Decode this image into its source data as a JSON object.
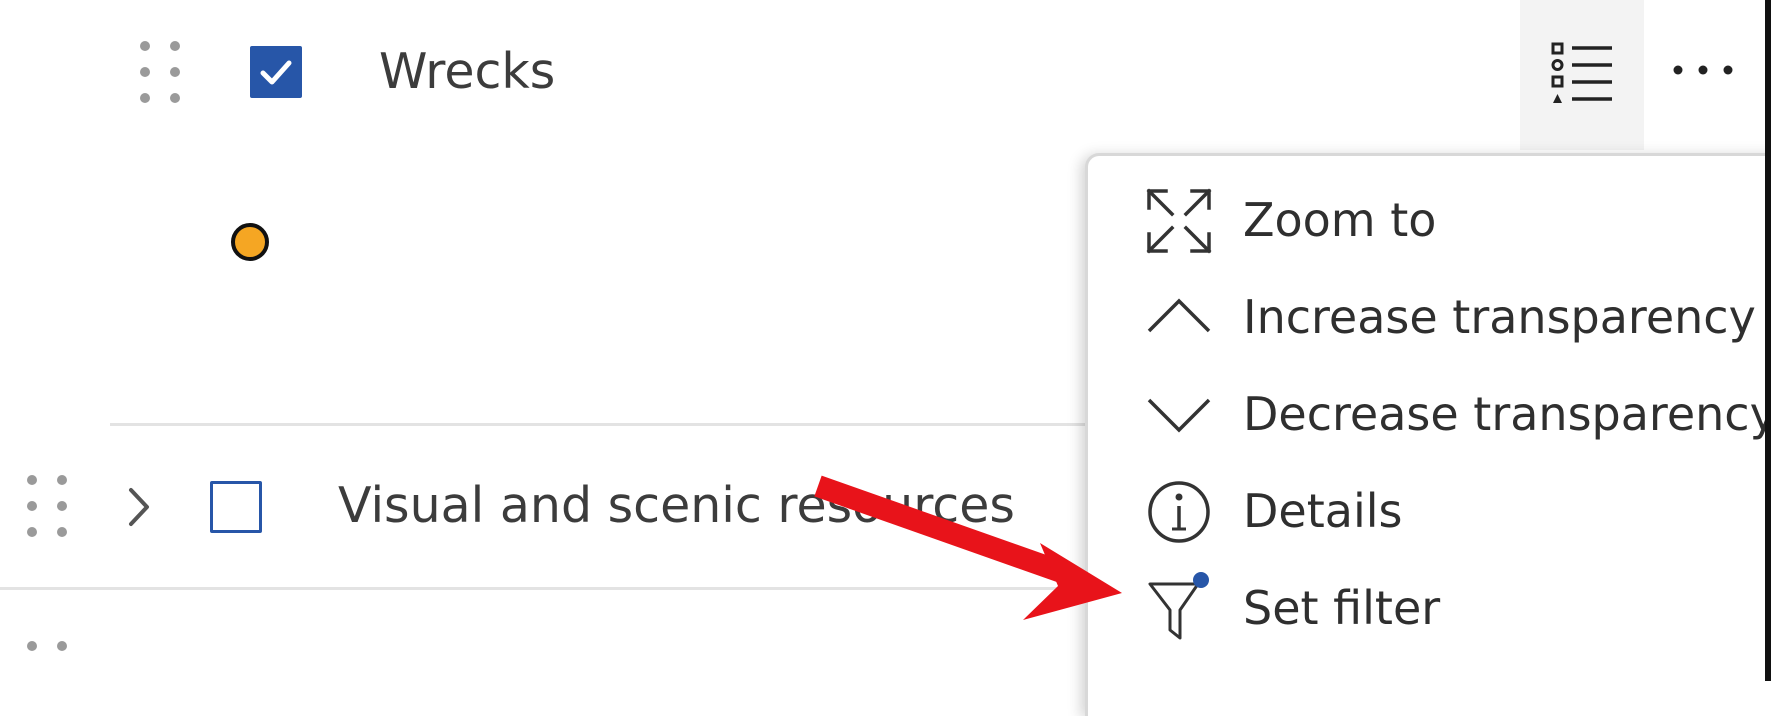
{
  "layers": {
    "wrecks": {
      "label": "Wrecks",
      "checked": true,
      "symbol_color": "#f5a623"
    },
    "visual": {
      "label": "Visual and scenic resources",
      "checked": false
    }
  },
  "icons": {
    "drag_handle": "drag-handle-icon",
    "checkbox": "checkbox-icon",
    "legend": "legend-list-icon",
    "more": "more-options-icon",
    "expand": "chevron-right-icon"
  },
  "context_menu": {
    "items": [
      {
        "label": "Zoom to",
        "icon": "zoom-to-icon"
      },
      {
        "label": "Increase transparency",
        "icon": "chevron-up-icon"
      },
      {
        "label": "Decrease transparency",
        "icon": "chevron-down-icon"
      },
      {
        "label": "Details",
        "icon": "info-icon"
      },
      {
        "label": "Set filter",
        "icon": "filter-icon"
      }
    ]
  },
  "colors": {
    "accent": "#2756a8",
    "annotation_arrow": "#e8131a",
    "filter_dot": "#2756a8"
  }
}
